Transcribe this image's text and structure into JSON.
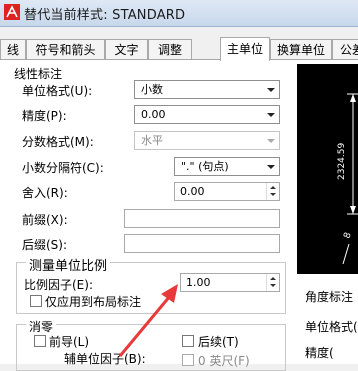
{
  "title": "替代当前样式: STANDARD",
  "tabs": [
    "线",
    "符号和箭头",
    "文字",
    "调整",
    "主单位",
    "换算单位",
    "公差"
  ],
  "linear": {
    "section_title": "线性标注",
    "unit_format_label": "单位格式(U):",
    "unit_format_value": "小数",
    "precision_label": "精度(P):",
    "precision_value": "0.00",
    "fraction_format_label": "分数格式(M):",
    "fraction_format_value": "水平",
    "decimal_sep_label": "小数分隔符(C):",
    "decimal_sep_value": "\".\" (句点)",
    "round_label": "舍入(R):",
    "round_value": "0.00",
    "prefix_label": "前缀(X):",
    "prefix_value": "",
    "suffix_label": "后缀(S):",
    "suffix_value": ""
  },
  "scale": {
    "section_title": "测量单位比例",
    "factor_label": "比例因子(E):",
    "factor_value": "1.00",
    "layout_only_label": "仅应用到布局标注"
  },
  "zero": {
    "section_title": "消零",
    "leading_label": "前导(L)",
    "trailing_label": "后续(T)",
    "sub_factor_label": "辅单位因子(B):",
    "feet_label": "0 英尺(F)"
  },
  "angular": {
    "section_title": "角度标注",
    "unit_format_partial": "单位格式(",
    "precision_partial": "精度("
  },
  "preview": {
    "dimension_text": "2324.59"
  },
  "colors": {
    "arrow": "#e83a3a",
    "preview_bg": "#000000",
    "title_text": "#1b1b1b"
  }
}
